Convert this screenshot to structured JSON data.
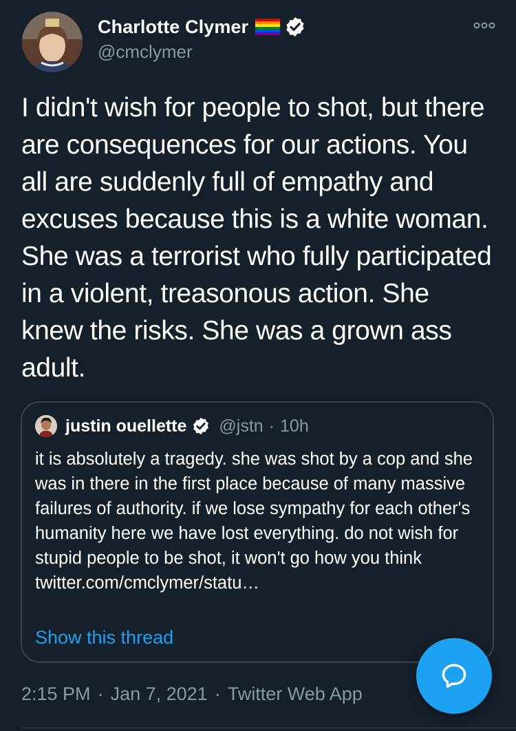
{
  "author": {
    "display_name": "Charlotte Clymer",
    "handle": "@cmclymer",
    "badges": [
      "rainbow-flag-icon",
      "verified-badge-icon"
    ]
  },
  "tweet": {
    "text": "I didn't wish for people to shot, but there are consequences for our actions. You all are suddenly full of empathy and excuses because this is a white woman. She was a terrorist who fully participated in a violent, treasonous action. She knew the risks. She was a grown ass adult."
  },
  "quoted_tweet": {
    "display_name": "justin ouellette",
    "handle": "@jstn",
    "separator": "·",
    "time": "10h",
    "text": "it is absolutely a tragedy. she was shot by a cop and she was in there in the first place because of many massive failures of authority. if we lose sympathy for each other's humanity here we have lost everything. do not wish for stupid people to be shot, it won't go how you think twitter.com/cmclymer/statu…",
    "show_thread_label": "Show this thread"
  },
  "meta": {
    "time": "2:15 PM",
    "separator": "·",
    "date": "Jan 7, 2021",
    "source": "Twitter Web App"
  },
  "icons": {
    "more": "more-options-icon",
    "compose": "chat-bubble-icon"
  },
  "colors": {
    "background": "#15202b",
    "text_primary": "#ffffff",
    "text_secondary": "#8899a6",
    "accent": "#1da1f2",
    "border": "#38444d"
  }
}
